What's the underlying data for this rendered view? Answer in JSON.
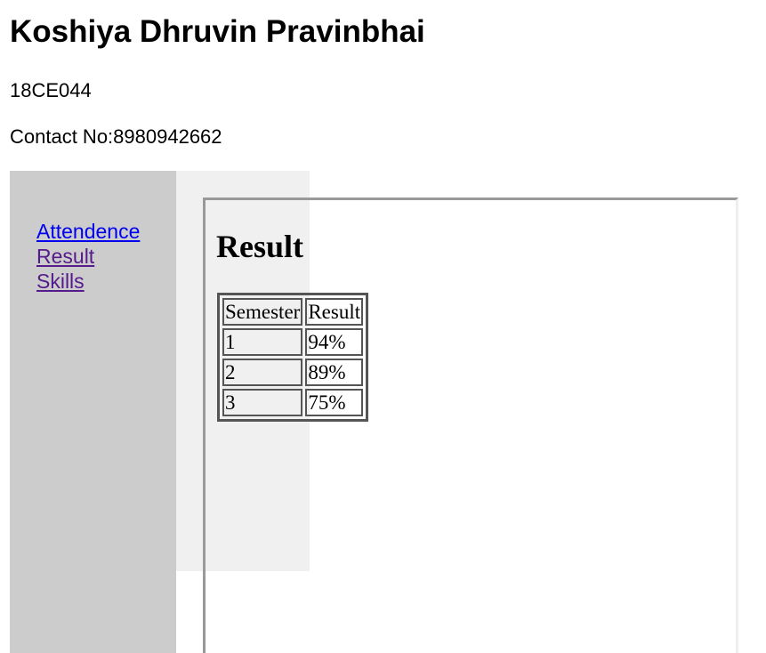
{
  "header": {
    "name": "Koshiya Dhruvin Pravinbhai",
    "student_id": "18CE044",
    "contact": "Contact No:8980942662"
  },
  "nav": {
    "links": [
      {
        "label": "Attendence"
      },
      {
        "label": "Result"
      },
      {
        "label": "Skills"
      }
    ]
  },
  "main": {
    "heading": "Result",
    "table": {
      "headers": [
        "Semester",
        "Result"
      ],
      "rows": [
        [
          "1",
          "94%"
        ],
        [
          "2",
          "89%"
        ],
        [
          "3",
          "75%"
        ]
      ]
    }
  },
  "colors": {
    "nav_background": "#cccccc",
    "secondary_background": "#f0f0f0",
    "unvisited_link": "#0000ee",
    "visited_link": "#551a8b"
  }
}
